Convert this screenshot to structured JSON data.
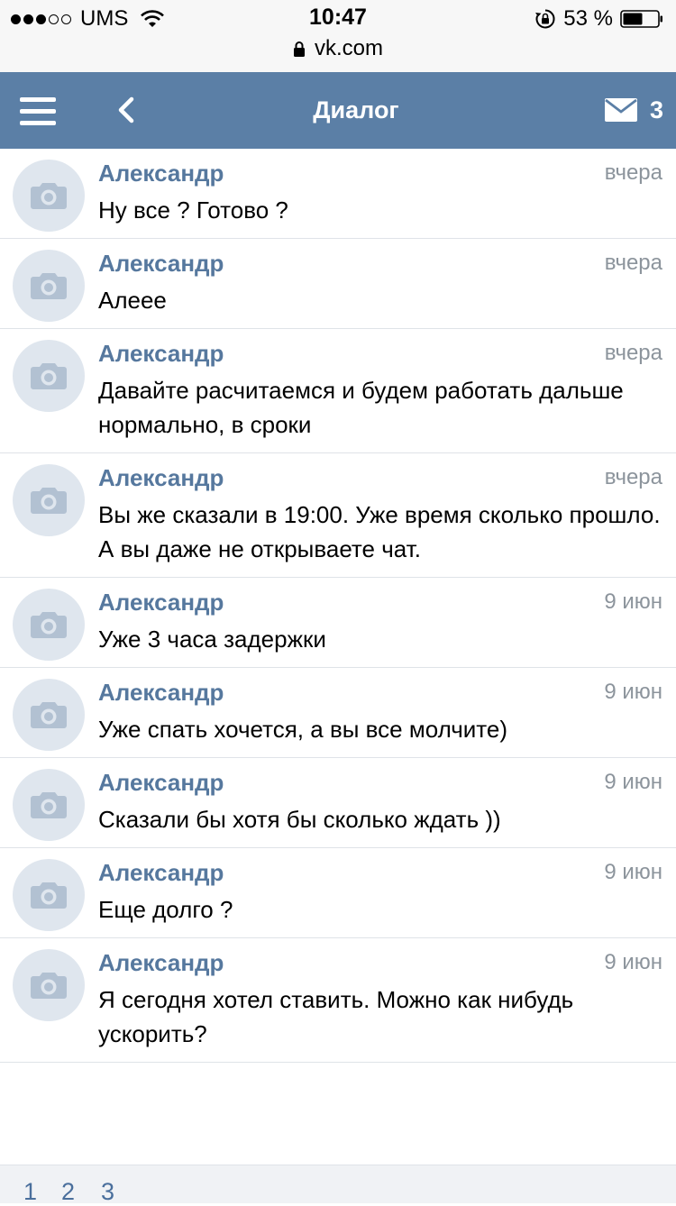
{
  "status_bar": {
    "carrier": "UMS",
    "time": "10:47",
    "url": "vk.com",
    "battery": "53 %",
    "signal_bars": 3
  },
  "header": {
    "title": "Диалог",
    "mail_count": "3",
    "accent_color": "#5b7fa6"
  },
  "messages": [
    {
      "name": "Александр",
      "date": "вчера",
      "text": "Ну все ? Готово ?"
    },
    {
      "name": "Александр",
      "date": "вчера",
      "text": "Алеее"
    },
    {
      "name": "Александр",
      "date": "вчера",
      "text": "Давайте расчитаемся и будем работать дальше нормально, в сроки"
    },
    {
      "name": "Александр",
      "date": "вчера",
      "text": "Вы же сказали в 19:00. Уже время сколько прошло. А вы даже не открываете чат."
    },
    {
      "name": "Александр",
      "date": "9 июн",
      "text": "Уже 3 часа задержки"
    },
    {
      "name": "Александр",
      "date": "9 июн",
      "text": "Уже спать хочется, а вы все молчите)"
    },
    {
      "name": "Александр",
      "date": "9 июн",
      "text": "Сказали бы хотя бы сколько ждать ))"
    },
    {
      "name": "Александр",
      "date": "9 июн",
      "text": "Еще долго ?"
    },
    {
      "name": "Александр",
      "date": "9 июн",
      "text": "Я сегодня хотел ставить. Можно как нибудь ускорить?"
    }
  ],
  "pagination": {
    "pages": [
      "1",
      "2",
      "3"
    ]
  }
}
